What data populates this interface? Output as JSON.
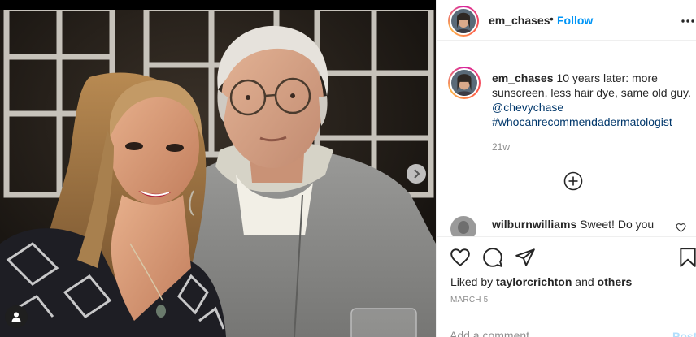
{
  "photo": {
    "description_icon": "person-tag-icon",
    "next_icon": "chevron-right-icon"
  },
  "header": {
    "username": "em_chases",
    "separator": "•",
    "follow_label": "Follow",
    "more_icon": "more-horizontal-icon"
  },
  "caption": {
    "username": "em_chases",
    "text": "10 years later: more sunscreen, less hair dye, same old guy.",
    "mention": "@chevychase",
    "hashtag": "#whocanrecommendadermatologist",
    "time": "21w"
  },
  "load_more_icon": "plus-circle-icon",
  "comments": [
    {
      "username": "wilburnwilliams",
      "text": "Sweet! Do you"
    }
  ],
  "actions": {
    "icons": [
      "heart-icon",
      "comment-icon",
      "share-icon",
      "bookmark-icon"
    ],
    "liked_by_prefix": "Liked by",
    "liked_by_user": "taylorcrichton",
    "liked_by_and": "and",
    "liked_by_others": "others",
    "date": "MARCH 5"
  },
  "add_comment": {
    "placeholder": "Add a comment…",
    "post_label": "Post"
  },
  "colors": {
    "link": "#00376b",
    "follow": "#0095f6",
    "post_disabled": "#b2dffc",
    "muted": "#8e8e8e"
  }
}
